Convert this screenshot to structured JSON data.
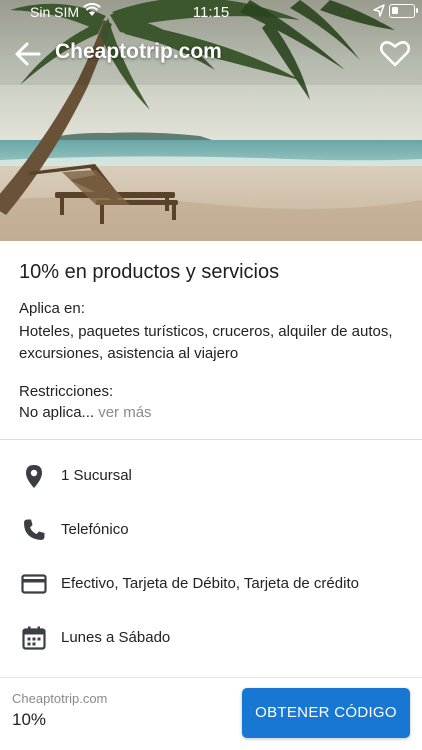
{
  "status_bar": {
    "carrier": "Sin SIM",
    "time": "11:15"
  },
  "app_bar": {
    "title": "Cheaptotrip.com",
    "back_icon": "arrow-left-icon",
    "favorite_icon": "heart-outline-icon"
  },
  "offer": {
    "title": "10% en productos y servicios",
    "applies_label": "Aplica en:",
    "applies_text": "Hoteles, paquetes turísticos, cruceros, alquiler de autos, excursiones, asistencia al viajero",
    "restrictions_label": "Restricciones:",
    "restrictions_text": "No aplica...",
    "see_more": "ver más"
  },
  "details": [
    {
      "icon": "location-pin-icon",
      "text": "1 Sucursal"
    },
    {
      "icon": "phone-icon",
      "text": "Telefónico"
    },
    {
      "icon": "credit-card-icon",
      "text": "Efectivo, Tarjeta de Débito, Tarjeta de crédito"
    },
    {
      "icon": "calendar-icon",
      "text": "Lunes a Sábado"
    }
  ],
  "footer": {
    "merchant": "Cheaptotrip.com",
    "discount": "10%",
    "cta_label": "OBTENER CÓDIGO"
  },
  "colors": {
    "primary": "#1877d2",
    "icon": "#3b3f45",
    "muted": "#8a8a8a"
  }
}
